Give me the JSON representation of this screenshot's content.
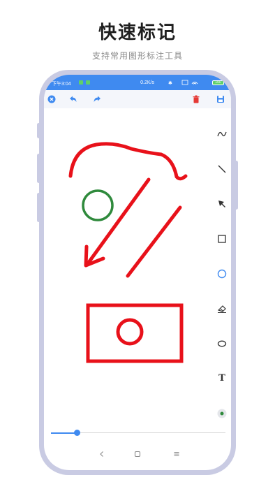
{
  "promo": {
    "title": "快速标记",
    "subtitle": "支持常用图形标注工具"
  },
  "statusbar": {
    "time": "下午3:04",
    "network": "0.2K/s",
    "battery": "100"
  },
  "toolbar": {
    "close": "close-icon",
    "undo": "undo-icon",
    "redo": "redo-icon",
    "delete": "trash-icon",
    "save": "save-icon"
  },
  "tools": {
    "text_label": "T",
    "items": [
      "freehand-icon",
      "line-icon",
      "arrow-icon",
      "rectangle-icon",
      "circle-icon",
      "eraser-icon",
      "ellipse-icon",
      "text-icon",
      "color-picker-icon"
    ],
    "active": "circle-icon"
  },
  "stroke_width": {
    "value": 0.15
  },
  "colors": {
    "accent": "#3f8af0",
    "ink_red": "#e8111a",
    "ink_green": "#2f8a3c",
    "frame": "#c9cbe3"
  },
  "navbar": {
    "back": "back-icon",
    "home": "home-icon",
    "menu": "menu-icon"
  }
}
